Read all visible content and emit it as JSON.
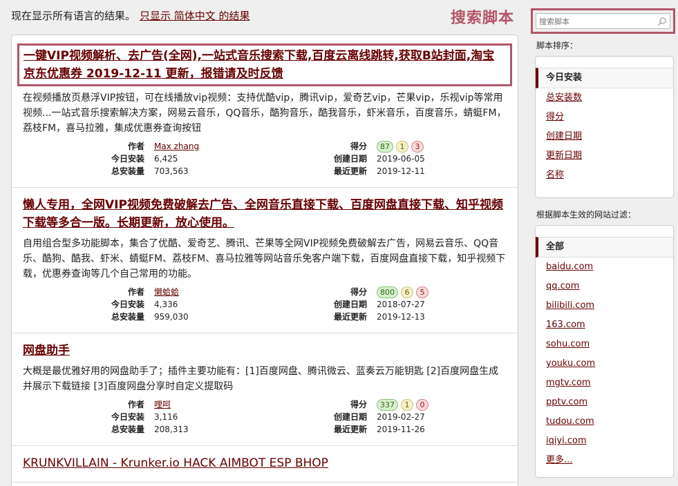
{
  "notice": {
    "text": "现在显示所有语言的结果。",
    "link": "只显示 简体中文 的结果"
  },
  "annotation": "搜索脚本",
  "scripts": [
    {
      "title": "一键VIP视频解析、去广告(全网),一站式音乐搜索下载,百度云离线跳转,获取B站封面,淘宝京东优惠券 2019-12-11 更新，报错请及时反馈",
      "desc": "在视频播放页悬浮VIP按钮，可在线播放vip视频：支持优酷vip，腾讯vip，爱奇艺vip，芒果vip，乐视vip等常用视频...一站式音乐搜索解决方案，网易云音乐，QQ音乐，酷狗音乐，酷我音乐，虾米音乐，百度音乐，蜻蜓FM，荔枝FM，喜马拉雅，集成优惠券查询按钮",
      "author": "Max zhang",
      "daily": "6,425",
      "total": "703,563",
      "score": [
        "87",
        "1",
        "3"
      ],
      "created": "2019-06-05",
      "updated": "2019-12-11"
    },
    {
      "title": "懒人专用，全网VIP视频免费破解去广告、全网音乐直接下载、百度网盘直接下载、知乎视频下载等多合一版。长期更新，放心使用。",
      "desc": "自用组合型多功能脚本，集合了优酷、爱奇艺、腾讯、芒果等全网VIP视频免费破解去广告，网易云音乐、QQ音乐、酷狗、酷我、虾米、蜻蜓FM、荔枝FM、喜马拉雅等网站音乐免客户端下载，百度网盘直接下载，知乎视频下载，优惠券查询等几个自己常用的功能。",
      "author": "懒蛤蛤",
      "daily": "4,336",
      "total": "959,030",
      "score": [
        "800",
        "6",
        "5"
      ],
      "created": "2018-07-27",
      "updated": "2019-12-13"
    },
    {
      "title": "网盘助手",
      "desc": "大概是最优雅好用的网盘助手了；插件主要功能有：[1]百度网盘、腾讯微云、蓝奏云万能钥匙 [2]百度网盘生成并展示下载链接 [3]百度网盘分享时自定义提取码",
      "author": "哩呵",
      "daily": "3,116",
      "total": "208,313",
      "score": [
        "337",
        "1",
        "0"
      ],
      "created": "2019-02-27",
      "updated": "2019-11-26"
    },
    {
      "title": "KRUNKVILLAIN - Krunker.io HACK AIMBOT ESP BHOP"
    }
  ],
  "meta_labels": {
    "author": "作者",
    "daily": "今日安装",
    "total": "总安装量",
    "score": "得分",
    "created": "创建日期",
    "updated": "最近更新"
  },
  "sidebar": {
    "search_placeholder": "搜索脚本",
    "sort_label": "脚本排序：",
    "sort_items": [
      "今日安装",
      "总安装数",
      "得分",
      "创建日期",
      "更新日期",
      "名称"
    ],
    "filter_label": "根据脚本生效的网站过滤：",
    "site_items": [
      "全部",
      "baidu.com",
      "qq.com",
      "bilibili.com",
      "163.com",
      "sohu.com",
      "youku.com",
      "mgtv.com",
      "pptv.com",
      "tudou.com",
      "iqiyi.com",
      "更多..."
    ]
  },
  "colors": {
    "link": "#670000",
    "annotation": "#b25567",
    "score_good": "#d7f0cc",
    "score_ok": "#f5f1c9",
    "score_bad": "#f8d9d9"
  }
}
